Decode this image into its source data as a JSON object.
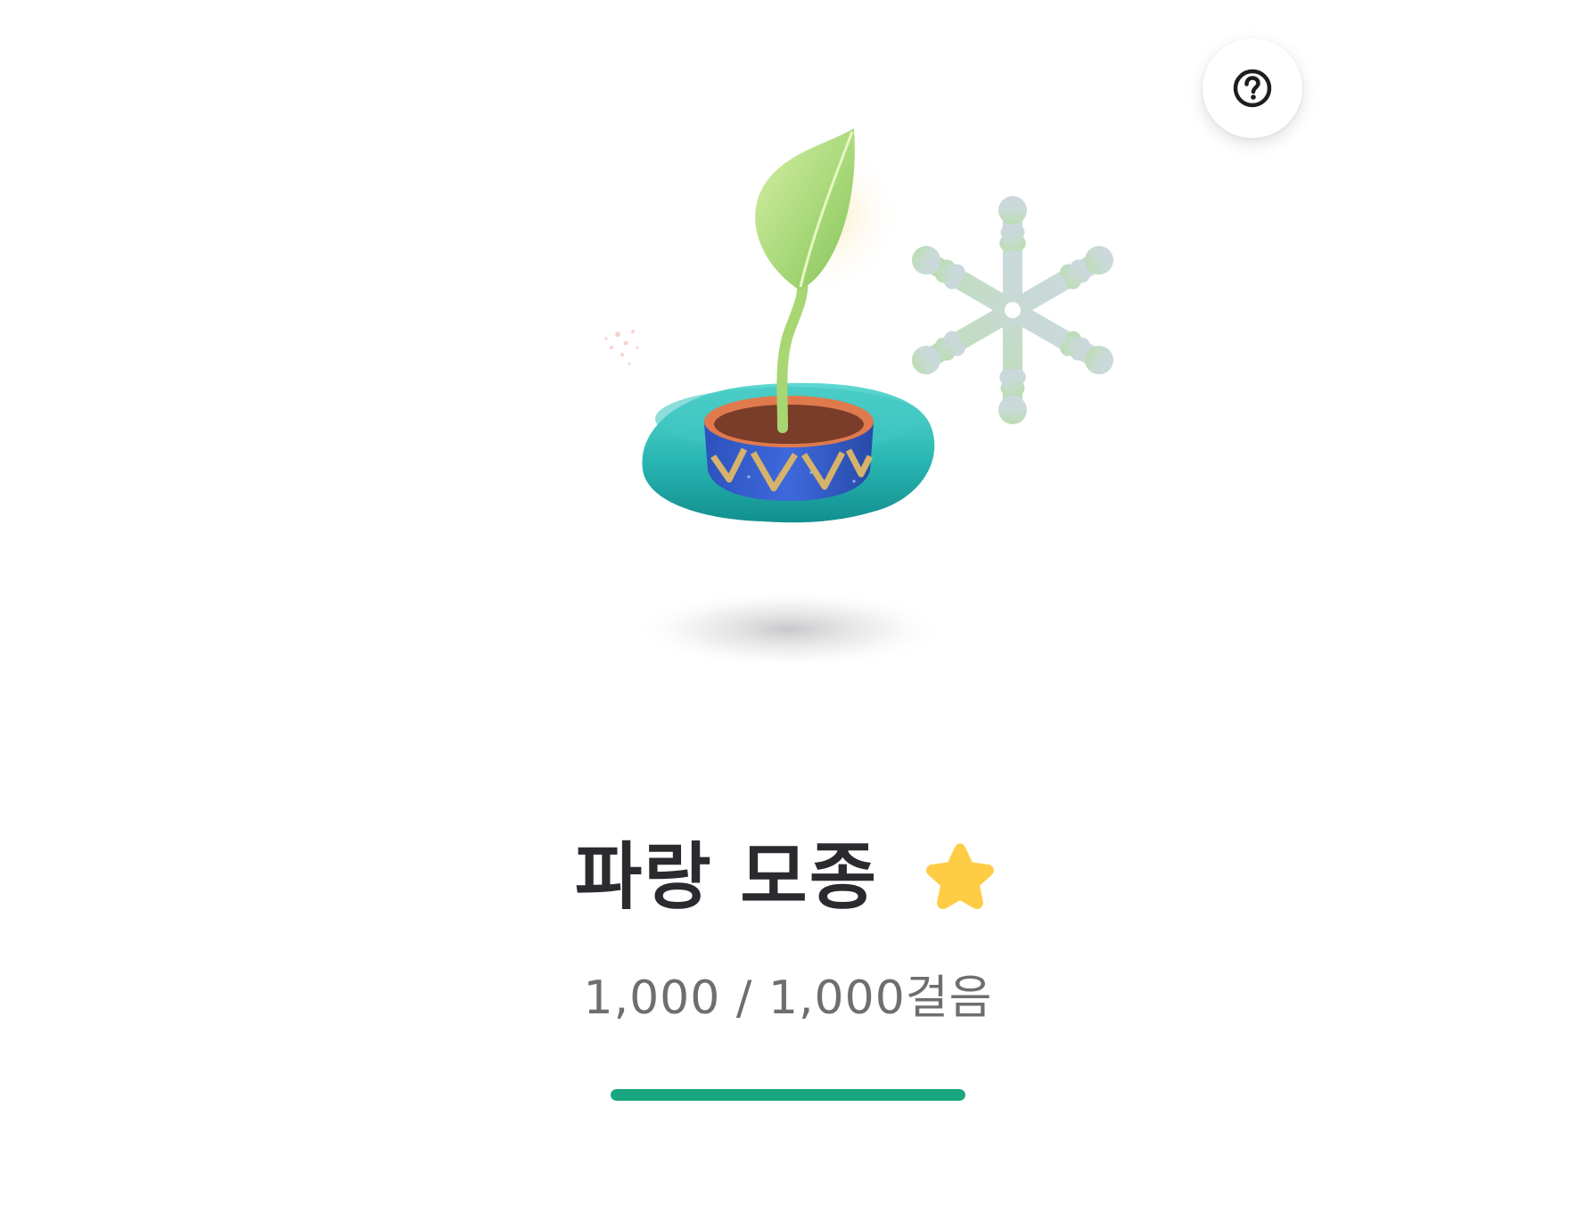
{
  "help": {
    "icon": "question-circle-icon"
  },
  "illustration": {
    "icons": [
      "plant-sprout-icon",
      "pot-icon",
      "snowflake-icon"
    ]
  },
  "plant": {
    "name": "파랑 모종",
    "star_icon": "star-icon",
    "star_color": "#FFCC45"
  },
  "steps": {
    "current": "1,000",
    "separator": " / ",
    "goal": "1,000",
    "unit": "걸음"
  },
  "progress": {
    "fraction": 1.0,
    "color": "#17A67F"
  }
}
